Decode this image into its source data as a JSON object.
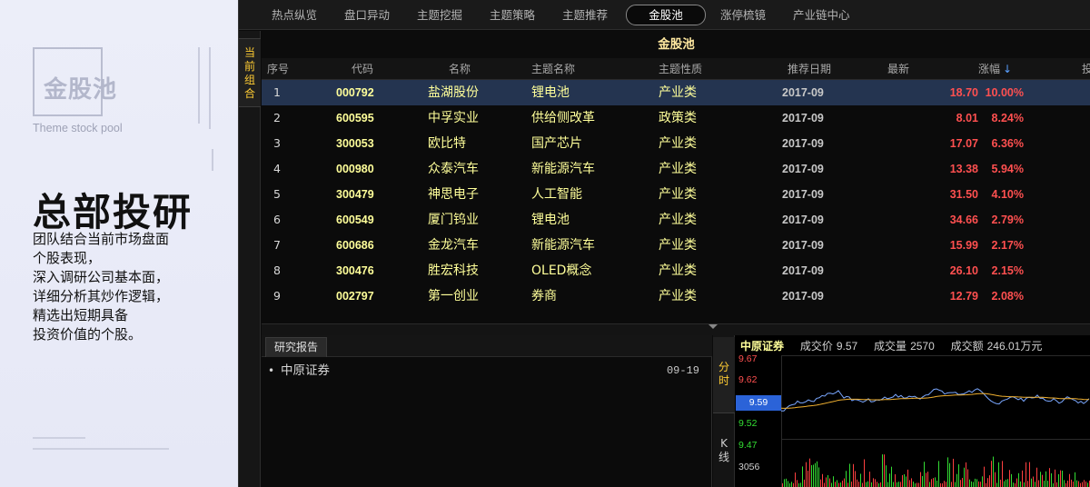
{
  "promo": {
    "logo_text": "金股池",
    "logo_subtitle": "Theme stock pool",
    "title": "总部投研",
    "description_lines": [
      "团队结合当前市场盘面",
      "个股表现，",
      "深入调研公司基本面，",
      "详细分析其炒作逻辑，",
      "精选出短期具备",
      "投资价值的个股。"
    ]
  },
  "nav": {
    "items": [
      "热点纵览",
      "盘口异动",
      "主题挖掘",
      "主题策略",
      "主题推荐",
      "金股池",
      "涨停梳镜",
      "产业链中心"
    ],
    "active_index": 5
  },
  "sidetab": {
    "label": "当前组合"
  },
  "pool": {
    "title": "金股池",
    "columns": [
      "序号",
      "代码",
      "名称",
      "主题名称",
      "主题性质",
      "推荐日期",
      "最新",
      "涨幅",
      "投"
    ],
    "sort_indicator": "↓",
    "rows": [
      {
        "seq": "1",
        "code": "000792",
        "name": "盐湖股份",
        "theme": "锂电池",
        "nature": "产业类",
        "date": "2017-09",
        "price": "18.70",
        "change": "10.00%"
      },
      {
        "seq": "2",
        "code": "600595",
        "name": "中孚实业",
        "theme": "供给侧改革",
        "nature": "政策类",
        "date": "2017-09",
        "price": "8.01",
        "change": "8.24%"
      },
      {
        "seq": "3",
        "code": "300053",
        "name": "欧比特",
        "theme": "国产芯片",
        "nature": "产业类",
        "date": "2017-09",
        "price": "17.07",
        "change": "6.36%"
      },
      {
        "seq": "4",
        "code": "000980",
        "name": "众泰汽车",
        "theme": "新能源汽车",
        "nature": "产业类",
        "date": "2017-09",
        "price": "13.38",
        "change": "5.94%"
      },
      {
        "seq": "5",
        "code": "300479",
        "name": "神思电子",
        "theme": "人工智能",
        "nature": "产业类",
        "date": "2017-09",
        "price": "31.50",
        "change": "4.10%"
      },
      {
        "seq": "6",
        "code": "600549",
        "name": "厦门钨业",
        "theme": "锂电池",
        "nature": "产业类",
        "date": "2017-09",
        "price": "34.66",
        "change": "2.79%"
      },
      {
        "seq": "7",
        "code": "600686",
        "name": "金龙汽车",
        "theme": "新能源汽车",
        "nature": "产业类",
        "date": "2017-09",
        "price": "15.99",
        "change": "2.17%"
      },
      {
        "seq": "8",
        "code": "300476",
        "name": "胜宏科技",
        "theme": "OLED概念",
        "nature": "产业类",
        "date": "2017-09",
        "price": "26.10",
        "change": "2.15%"
      },
      {
        "seq": "9",
        "code": "002797",
        "name": "第一创业",
        "theme": "券商",
        "nature": "产业类",
        "date": "2017-09",
        "price": "12.79",
        "change": "2.08%"
      }
    ],
    "selected_index": 0
  },
  "report": {
    "tab_label": "研究报告",
    "items": [
      {
        "name": "中原证券",
        "date": "09-19"
      }
    ]
  },
  "mini_chart": {
    "tab_fenshi": "分时",
    "tab_kxian": "K线",
    "stock_name": "中原证券",
    "info": [
      {
        "label": "成交价",
        "value": "9.57"
      },
      {
        "label": "成交量",
        "value": "2570"
      },
      {
        "label": "成交额",
        "value": "246.01万元"
      }
    ],
    "price_axis": [
      {
        "value": "9.67",
        "color": "#ff5050"
      },
      {
        "value": "9.62",
        "color": "#ff5050"
      },
      {
        "value": "9.52",
        "color": "#33dd33"
      },
      {
        "value": "9.47",
        "color": "#33dd33"
      }
    ],
    "current_price": "9.59",
    "volume_axis_label": "3056",
    "colors": {
      "price_line": "#7aa7ff",
      "avg_line": "#f0b030",
      "vol_up": "#ff4040",
      "vol_down": "#33dd33"
    }
  }
}
